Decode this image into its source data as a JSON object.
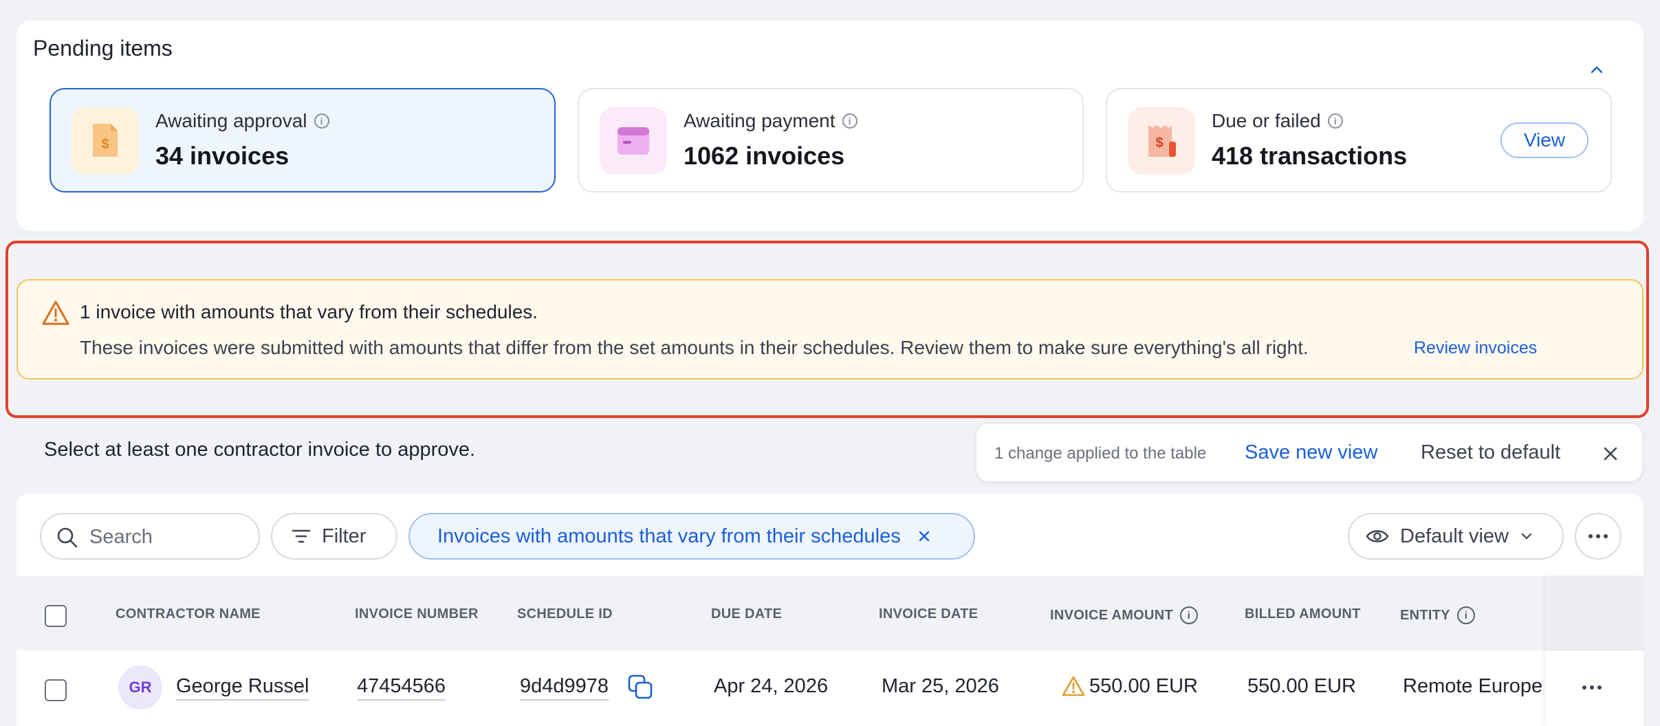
{
  "pending": {
    "title": "Pending items",
    "cards": [
      {
        "label": "Awaiting approval",
        "value": "34 invoices",
        "icon": "invoice-dollar-icon"
      },
      {
        "label": "Awaiting payment",
        "value": "1062 invoices",
        "icon": "card-icon"
      },
      {
        "label": "Due or failed",
        "value": "418 transactions",
        "icon": "receipt-alert-icon",
        "action": "View"
      }
    ]
  },
  "alert": {
    "title": "1 invoice with amounts that vary from their schedules.",
    "text": "These invoices were submitted with amounts that differ from the set amounts in their schedules. Review them to make sure everything's all right.",
    "link": "Review invoices"
  },
  "selection_note": "Select at least one contractor invoice to approve.",
  "changes_bar": {
    "text": "1 change applied to the table",
    "save": "Save new view",
    "reset": "Reset to default"
  },
  "toolbar": {
    "search_placeholder": "Search",
    "filter": "Filter",
    "active_filter": "Invoices with amounts that vary from their schedules",
    "view": "Default view"
  },
  "table": {
    "headers": {
      "contractor": "CONTRACTOR NAME",
      "invoice_number": "INVOICE NUMBER",
      "schedule_id": "SCHEDULE ID",
      "due_date": "DUE DATE",
      "invoice_date": "INVOICE DATE",
      "invoice_amount": "INVOICE AMOUNT",
      "billed_amount": "BILLED AMOUNT",
      "entity": "ENTITY"
    },
    "rows": [
      {
        "initials": "GR",
        "contractor": "George Russel",
        "invoice_number": "47454566",
        "schedule_id": "9d4d9978",
        "due_date": "Apr 24, 2026",
        "invoice_date": "Mar 25, 2026",
        "invoice_amount": "550.00 EUR",
        "billed_amount": "550.00 EUR",
        "entity": "Remote Europe"
      }
    ]
  },
  "colors": {
    "accent": "#1b5fd8",
    "alert_bg": "#fff8ec",
    "alert_border": "#f4c45a",
    "highlight": "#e0412c"
  }
}
